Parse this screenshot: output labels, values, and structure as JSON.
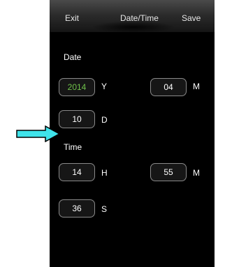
{
  "header": {
    "exit_label": "Exit",
    "title": "Date/Time",
    "save_label": "Save"
  },
  "date": {
    "section_label": "Date",
    "year_value": "2014",
    "year_unit": "Y",
    "month_value": "04",
    "month_unit": "M",
    "day_value": "10",
    "day_unit": "D"
  },
  "time": {
    "section_label": "Time",
    "hour_value": "14",
    "hour_unit": "H",
    "minute_value": "55",
    "minute_unit": "M",
    "second_value": "36",
    "second_unit": "S"
  },
  "colors": {
    "screen_background": "#000000",
    "year_value_color": "#6fc24a",
    "annotation_arrow": "#3fe3ea"
  },
  "annotation": {
    "icon": "pointer-arrow-icon"
  }
}
